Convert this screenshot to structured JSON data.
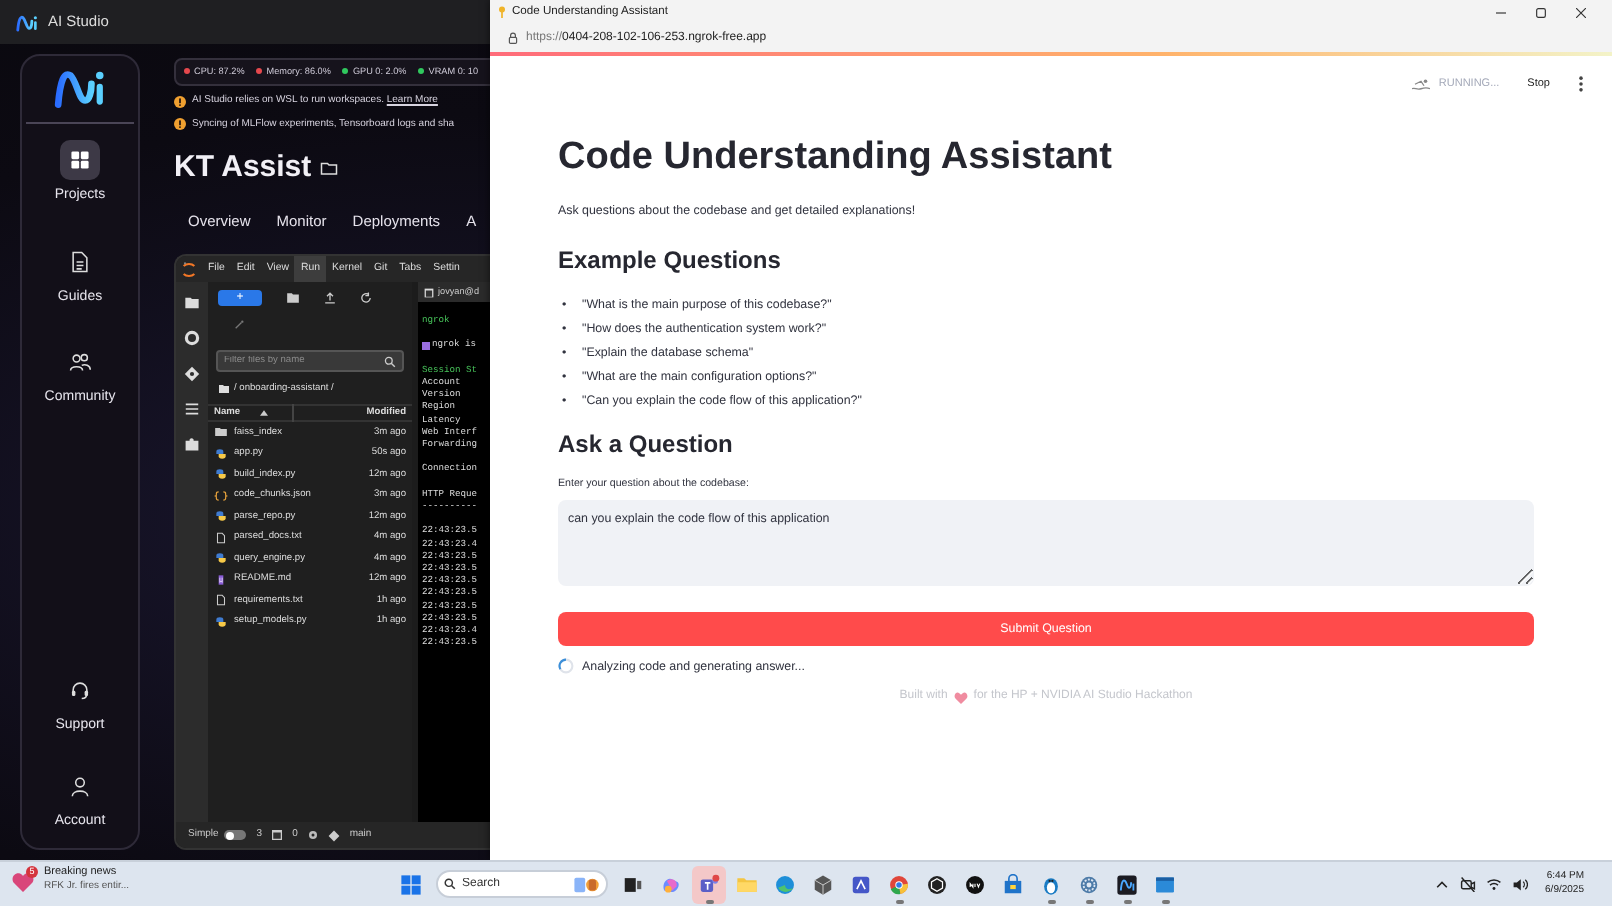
{
  "ai_studio": {
    "title": "AI Studio",
    "sidebar": {
      "items": [
        {
          "label": "Projects",
          "kind": "grid",
          "selected": true
        },
        {
          "label": "Guides",
          "kind": "document",
          "selected": false
        },
        {
          "label": "Community",
          "kind": "people",
          "selected": false
        }
      ],
      "bottom_items": [
        {
          "label": "Support",
          "kind": "headset",
          "selected": false
        },
        {
          "label": "Account",
          "kind": "person",
          "selected": false
        }
      ]
    },
    "stats": [
      {
        "label": "CPU: 87.2%",
        "color": "#e5484d"
      },
      {
        "label": "Memory: 86.0%",
        "color": "#e5484d"
      },
      {
        "label": "GPU 0: 2.0%",
        "color": "#30c85e"
      },
      {
        "label": "VRAM 0: 10",
        "color": "#30c85e"
      }
    ],
    "notices": [
      {
        "text": "AI Studio relies on WSL to run workspaces.",
        "link": "Learn More"
      },
      {
        "text": "Syncing of MLFlow experiments, Tensorboard logs and sha"
      }
    ],
    "project_title": "KT Assist",
    "tabs": [
      "Overview",
      "Monitor",
      "Deployments",
      "A"
    ]
  },
  "jupyter": {
    "menu": [
      {
        "label": "File",
        "selected": false
      },
      {
        "label": "Edit",
        "selected": false
      },
      {
        "label": "View",
        "selected": false
      },
      {
        "label": "Run",
        "selected": true
      },
      {
        "label": "Kernel",
        "selected": false
      },
      {
        "label": "Git",
        "selected": false
      },
      {
        "label": "Tabs",
        "selected": false
      },
      {
        "label": "Settin",
        "selected": false
      }
    ],
    "new_button": "+",
    "filter": {
      "placeholder": "Filter files by name"
    },
    "path": "/ onboarding-assistant /",
    "columns": [
      "Name",
      "Modified"
    ],
    "files": [
      {
        "name": "faiss_index",
        "kind": "folder",
        "modified": "3m ago"
      },
      {
        "name": "app.py",
        "kind": "python",
        "modified": "50s ago"
      },
      {
        "name": "build_index.py",
        "kind": "python",
        "modified": "12m ago"
      },
      {
        "name": "code_chunks.json",
        "kind": "json",
        "modified": "3m ago"
      },
      {
        "name": "parse_repo.py",
        "kind": "python",
        "modified": "12m ago"
      },
      {
        "name": "parsed_docs.txt",
        "kind": "text",
        "modified": "4m ago"
      },
      {
        "name": "query_engine.py",
        "kind": "python",
        "modified": "4m ago"
      },
      {
        "name": "README.md",
        "kind": "markdown",
        "modified": "12m ago"
      },
      {
        "name": "requirements.txt",
        "kind": "text",
        "modified": "1h ago"
      },
      {
        "name": "setup_models.py",
        "kind": "python",
        "modified": "1h ago"
      }
    ],
    "terminal": {
      "tab": "jovyan@d",
      "blocks": [
        [
          {
            "text": "ngrok",
            "kind": "title"
          }
        ],
        [
          {
            "text": "ngrok is",
            "kind": "notice"
          }
        ],
        [
          {
            "text": "Session St",
            "kind": "title"
          },
          {
            "text": "Account",
            "kind": "plain"
          },
          {
            "text": "Version",
            "kind": "plain"
          },
          {
            "text": "Region",
            "kind": "plain"
          },
          {
            "text": "Latency",
            "kind": "plain"
          },
          {
            "text": "Web Interf",
            "kind": "plain"
          },
          {
            "text": "Forwarding",
            "kind": "plain"
          }
        ],
        [
          {
            "text": "Connection",
            "kind": "plain"
          }
        ],
        [
          {
            "text": "HTTP Reque",
            "kind": "plain"
          },
          {
            "text": "----------",
            "kind": "plain"
          }
        ],
        [
          {
            "text": "22:43:23.5",
            "kind": "plain"
          },
          {
            "text": "22:43:23.4",
            "kind": "plain"
          },
          {
            "text": "22:43:23.5",
            "kind": "plain"
          },
          {
            "text": "22:43:23.5",
            "kind": "plain"
          },
          {
            "text": "22:43:23.5",
            "kind": "plain"
          },
          {
            "text": "22:43:23.5",
            "kind": "plain"
          },
          {
            "text": "22:43:23.5",
            "kind": "plain"
          },
          {
            "text": "22:43:23.5",
            "kind": "plain"
          },
          {
            "text": "22:43:23.4",
            "kind": "plain"
          },
          {
            "text": "22:43:23.5",
            "kind": "plain"
          }
        ]
      ]
    },
    "status_bar": {
      "mode": "Simple",
      "mode_on": false,
      "terminals": "3",
      "kernels": "0",
      "branch": "main"
    }
  },
  "browser": {
    "title": "Code Understanding Assistant",
    "url": "https://0404-208-102-106-253.ngrok-free.app",
    "status": "RUNNING...",
    "stop": "Stop",
    "page": {
      "title": "Code Understanding Assistant",
      "intro": "Ask questions about the codebase and get detailed explanations!",
      "examples_heading": "Example Questions",
      "examples": [
        {
          "marker": "•",
          "text": "\"What is the main purpose of this codebase?\""
        },
        {
          "marker": "•",
          "text": "\"How does the authentication system work?\""
        },
        {
          "marker": "•",
          "text": "\"Explain the database schema\""
        },
        {
          "marker": "•",
          "text": "\"What are the main configuration options?\""
        },
        {
          "marker": "•",
          "text": "\"Can you explain the code flow of this application?\""
        }
      ],
      "ask_heading": "Ask a Question",
      "question_label": "Enter your question about the codebase:",
      "question_value": "can you explain the code flow of this application",
      "submit": "Submit Question",
      "spinner": "Analyzing code and generating answer...",
      "footer_before": "Built with",
      "footer_after": "for the HP + NVIDIA AI Studio Hackathon"
    }
  },
  "taskbar": {
    "news": {
      "badge": "5",
      "title": "Breaking news",
      "subtitle": "RFK Jr. fires entir..."
    },
    "search": {
      "placeholder": "Search"
    },
    "apps": [
      {
        "kind": "start",
        "selected": false,
        "open": false
      },
      {
        "kind": "taskview",
        "selected": false,
        "open": false
      },
      {
        "kind": "copilot",
        "selected": false,
        "open": false
      },
      {
        "kind": "teams",
        "selected": true,
        "open": true
      },
      {
        "kind": "folder",
        "selected": false,
        "open": false
      },
      {
        "kind": "edge",
        "selected": false,
        "open": false
      },
      {
        "kind": "cube",
        "selected": false,
        "open": false
      },
      {
        "kind": "square",
        "selected": false,
        "open": false
      },
      {
        "kind": "chrome",
        "selected": false,
        "open": true
      },
      {
        "kind": "box",
        "selected": false,
        "open": false
      },
      {
        "kind": "dots",
        "selected": false,
        "open": false
      },
      {
        "kind": "store",
        "selected": false,
        "open": false
      },
      {
        "kind": "penguin",
        "selected": false,
        "open": true
      },
      {
        "kind": "gear",
        "selected": false,
        "open": true
      },
      {
        "kind": "aistudio",
        "selected": false,
        "open": true
      },
      {
        "kind": "window",
        "selected": false,
        "open": true
      }
    ],
    "tray": [
      {
        "kind": "chevron"
      },
      {
        "kind": "camera"
      },
      {
        "kind": "wifi"
      },
      {
        "kind": "volume"
      }
    ],
    "time": "6:44 PM",
    "date": "6/9/2025"
  }
}
